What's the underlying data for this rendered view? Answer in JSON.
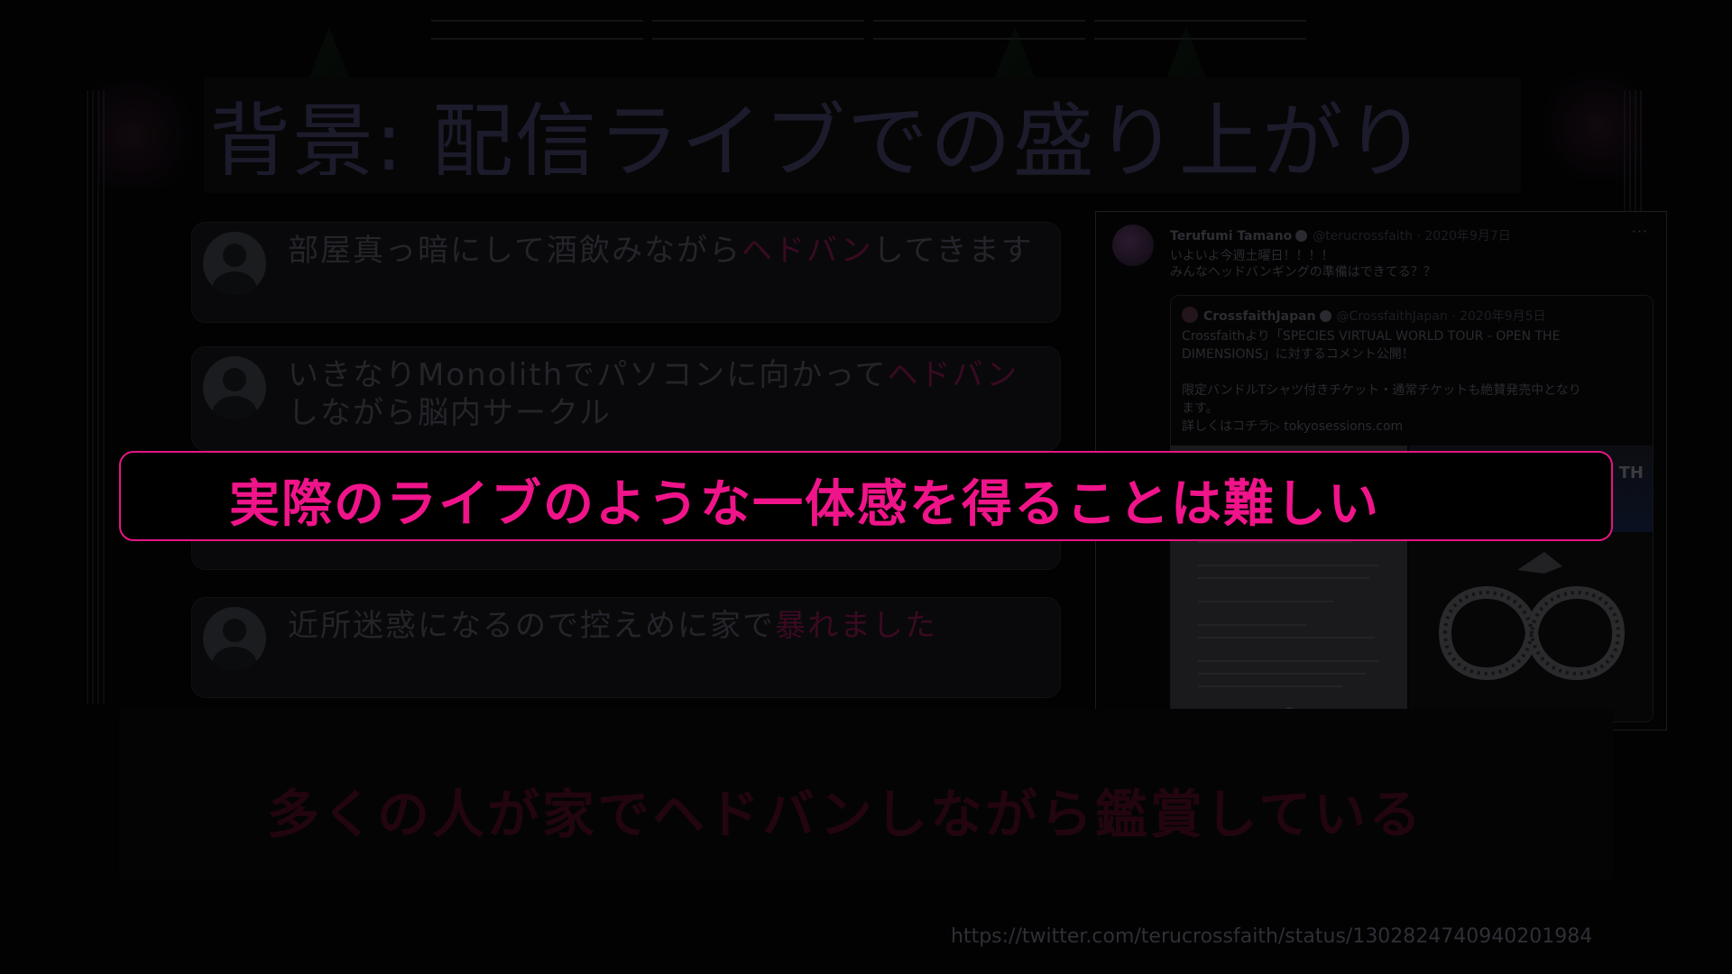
{
  "slide": {
    "title": "背景: 配信ライブでの盛り上がり",
    "comments": [
      {
        "before": "部屋真っ暗にして酒飲みながら",
        "highlight": "ヘドバン",
        "after": "してきます"
      },
      {
        "before": "いきなりMonolithでパソコンに向かって",
        "highlight": "ヘドバン",
        "after": "しながら脳内サークル"
      },
      {
        "before": "",
        "highlight": "",
        "after": ""
      },
      {
        "before": "近所迷惑になるので控えめに家で",
        "highlight": "暴れました",
        "after": ""
      }
    ],
    "callout": "実際のライブのような一体感を得ることは難しい",
    "bottom_message": "多くの人が家でヘドバンしながら鑑賞している",
    "source_url": "https://twitter.com/terucrossfaith/status/1302824740940201984"
  },
  "tweet": {
    "name": "Terufumi Tamano",
    "handle": "@terucrossfaith · 2020年9月7日",
    "more": "···",
    "lines": [
      "いよいよ今週土曜日！！！！",
      "みんなヘッドバンギングの準備はできてる？？"
    ],
    "quote": {
      "name": "CrossfaithJapan",
      "handle": "@CrossfaithJapan · 2020年9月5日",
      "lines": [
        "Crossfaithより「SPECIES VIRTUAL WORLD TOUR - OPEN THE",
        "DIMENSIONS」に対するコメント公開！",
        "限定バンドルTシャツ付きチケット・通常チケットも絶賛発売中となり",
        "ます。",
        "詳しくはコチラ▷ tokyosessions.com"
      ],
      "photo_text": "TH"
    }
  },
  "icons": {
    "avatar": "user-avatar-icon",
    "verified": "verified-badge-icon",
    "more": "more-options-icon"
  },
  "colors": {
    "accent": "#f0148a",
    "callout_border": "#e4167f",
    "background": "#020203"
  }
}
